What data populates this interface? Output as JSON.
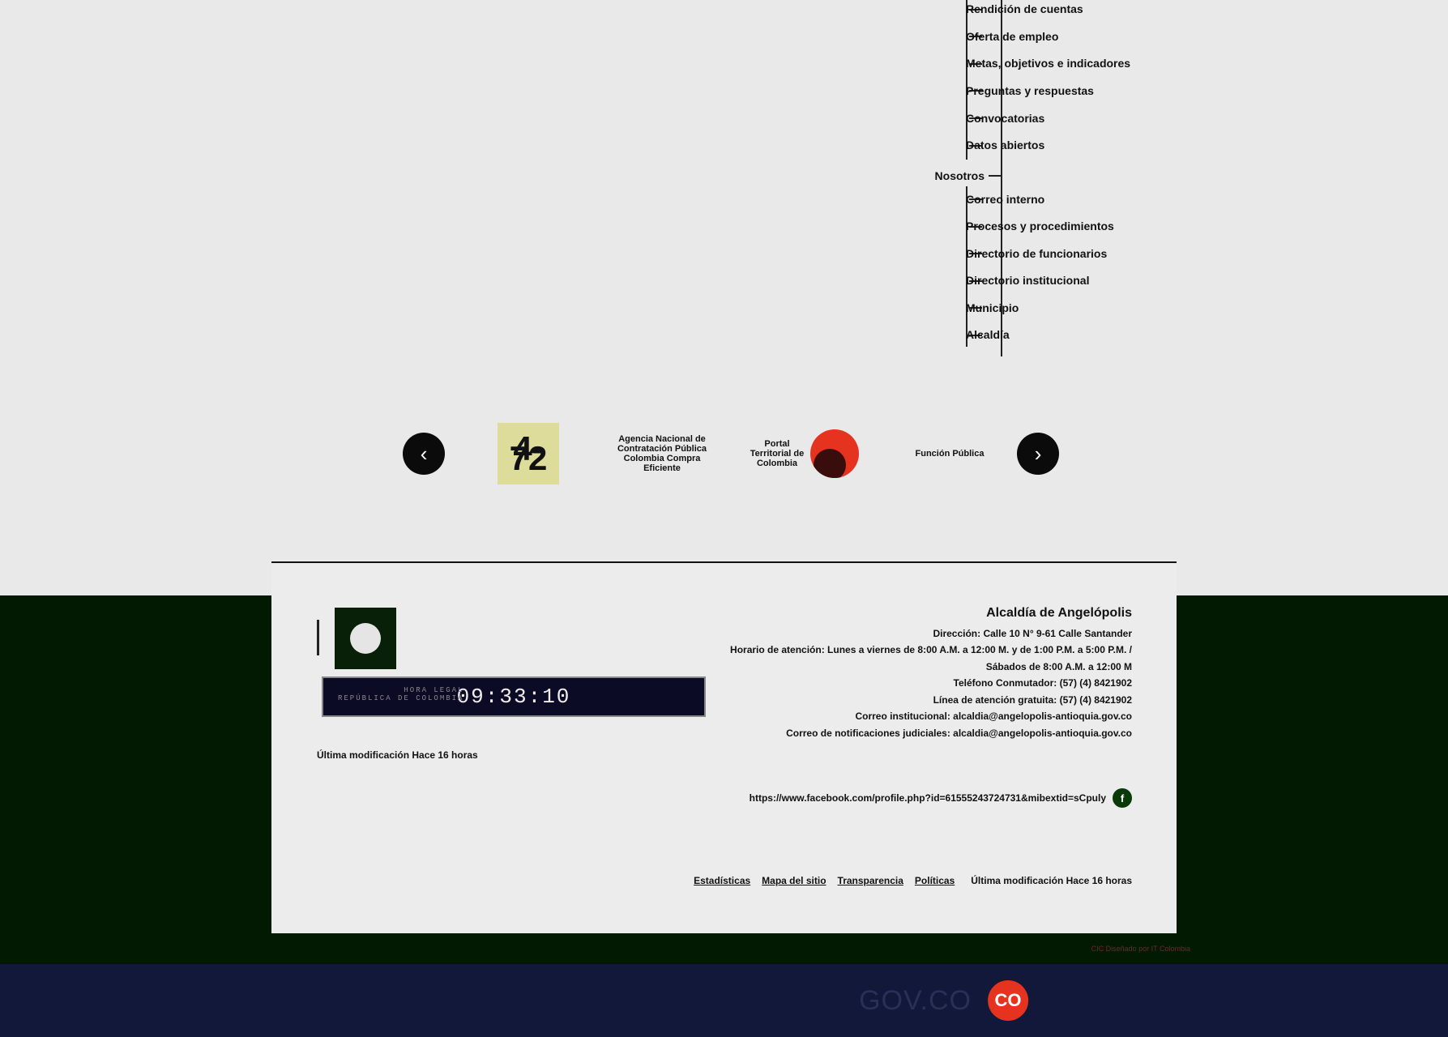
{
  "sitemap": {
    "transparencia_items": [
      "Rendición de cuentas",
      "Oferta de empleo",
      "Metas, objetivos e indicadores",
      "Preguntas y respuestas",
      "Convocatorias",
      "Datos abiertos"
    ],
    "nosotros_label": "Nosotros",
    "nosotros_items": [
      "Correo interno",
      "Procesos y procedimientos",
      "Directorio de funcionarios",
      "Directorio institucional",
      "Municipio",
      "Alcaldía"
    ]
  },
  "carousel": {
    "prev_icon": "chevron-left-icon",
    "next_icon": "chevron-right-icon",
    "logos": [
      "Función Pública",
      "Portal Territorial de Colombia",
      "Agencia Nacional de Contratación Pública Colombia Compra Eficiente",
      "4-72"
    ]
  },
  "footer": {
    "entity_name": "Alcaldía de Angelópolis",
    "lines": [
      "Dirección: Calle 10 N° 9-61 Calle Santander",
      "Horario de atención: Lunes a viernes de 8:00 A.M. a 12:00 M. y de 1:00 P.M. a 5:00 P.M. /",
      "Sábados de 8:00 A.M. a 12:00 M",
      "Teléfono Conmutador: (57) (4) 8421902",
      "Línea de atención gratuita: (57) (4) 8421902",
      "Correo institucional: alcaldia@angelopolis-antioquia.gov.co",
      "Correo de notificaciones judiciales: alcaldia@angelopolis-antioquia.gov.co"
    ],
    "facebook_url": "https://www.facebook.com/profile.php?id=61555243724731&mibextid=sCpuly",
    "last_modified": "Última modificación Hace 16 horas",
    "links": [
      "Políticas",
      "Transparencia",
      "Mapa del sitio",
      "Estadísticas"
    ],
    "clock": {
      "time": "09:33:10",
      "label_line1": "HORA LEGAL",
      "label_line2": "REPÚBLICA DE COLOMBIA"
    },
    "credit": "CIC Diseñado por IT Colombia",
    "gov_text": "GOV.CO",
    "co_badge": "CO"
  }
}
